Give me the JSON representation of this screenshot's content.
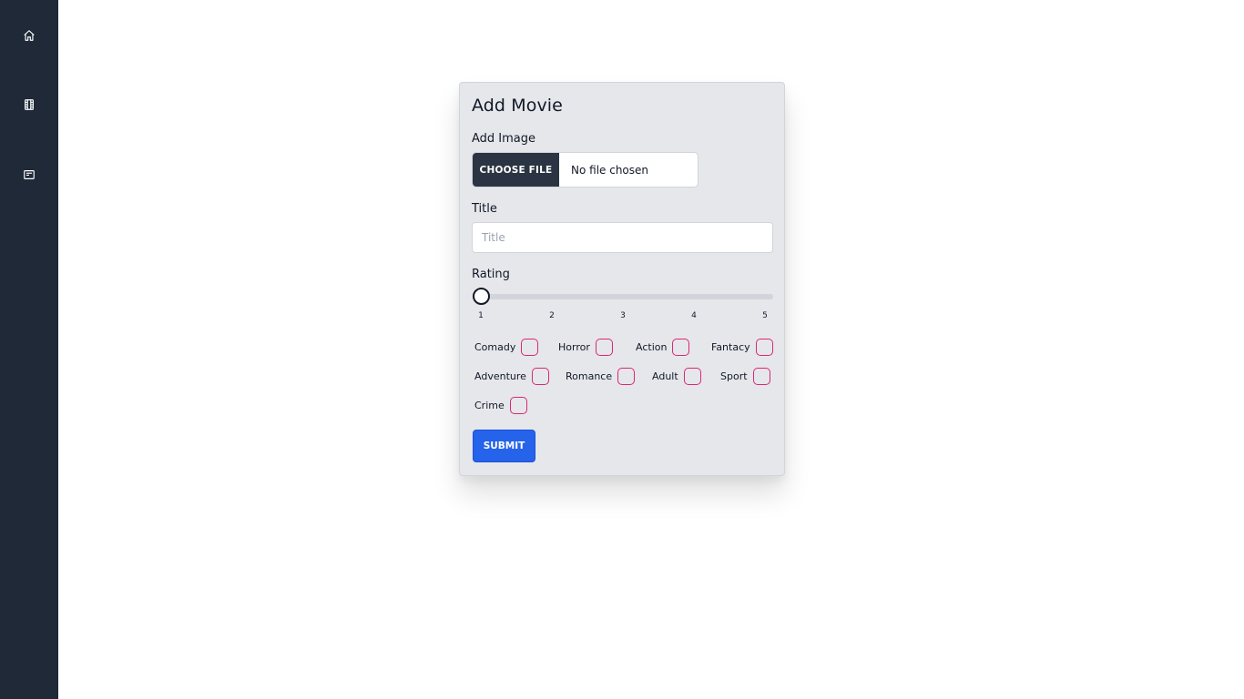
{
  "sidebar": {
    "items": [
      {
        "icon": "home-icon"
      },
      {
        "icon": "film-icon"
      },
      {
        "icon": "card-icon"
      }
    ]
  },
  "form": {
    "title": "Add Movie",
    "image_label": "Add Image",
    "file_button_label": "CHOOSE FILE",
    "file_status": "No file chosen",
    "title_label": "Title",
    "title_placeholder": "Title",
    "title_value": "",
    "rating_label": "Rating",
    "rating_value": 1,
    "rating_ticks": [
      "1",
      "2",
      "3",
      "4",
      "5"
    ],
    "genres": [
      {
        "label": "Comady",
        "checked": false
      },
      {
        "label": "Horror",
        "checked": false
      },
      {
        "label": "Action",
        "checked": false
      },
      {
        "label": "Fantacy",
        "checked": false
      },
      {
        "label": "Adventure",
        "checked": false
      },
      {
        "label": "Romance",
        "checked": false
      },
      {
        "label": "Adult",
        "checked": false
      },
      {
        "label": "Sport",
        "checked": false
      },
      {
        "label": "Crime",
        "checked": false
      }
    ],
    "submit_label": "SUBMIT"
  },
  "colors": {
    "sidebar_bg": "#1f2937",
    "card_bg": "#e5e7eb",
    "file_button_bg": "#2b3442",
    "checkbox_border": "#db2777",
    "submit_bg": "#2563eb"
  }
}
